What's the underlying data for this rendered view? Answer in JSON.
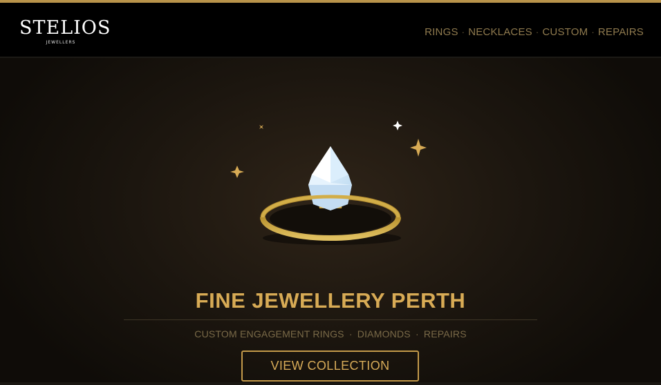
{
  "brand": {
    "name": "STELIOS",
    "sub": "JEWELLERS",
    "accent": "#d8ab55"
  },
  "nav": {
    "items": [
      {
        "label": "RINGS"
      },
      {
        "label": "NECKLACES"
      },
      {
        "label": "CUSTOM"
      },
      {
        "label": "REPAIRS"
      }
    ],
    "separator": "·"
  },
  "hero": {
    "title": "FINE JEWELLERY PERTH",
    "subtitle_items": [
      "CUSTOM ENGAGEMENT RINGS",
      "DIAMONDS",
      "REPAIRS"
    ],
    "separator": "·",
    "cta_label": "VIEW COLLECTION",
    "illustration": [
      "sparkle-icon",
      "diamond-ring-icon"
    ]
  }
}
